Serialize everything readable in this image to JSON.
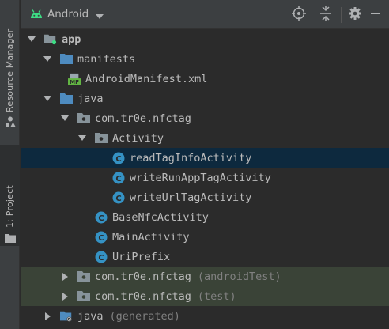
{
  "side_tabs": {
    "resource_manager": "Resource Manager",
    "project": "1: Project"
  },
  "header": {
    "view_label": "Android"
  },
  "tree": {
    "app": "app",
    "manifests": "manifests",
    "android_manifest": "AndroidManifest.xml",
    "java": "java",
    "pkg_main": "com.tr0e.nfctag",
    "activity_folder": "Activity",
    "read_tag": "readTagInfoActivity",
    "write_run_app": "writeRunAppTagActivity",
    "write_url": "writeUrlTagActivity",
    "base_nfc": "BaseNfcActivity",
    "main_activity": "MainActivity",
    "uri_prefix": "UriPrefix",
    "pkg_android_test": "com.tr0e.nfctag",
    "pkg_android_test_suffix": "(androidTest)",
    "pkg_test": "com.tr0e.nfctag",
    "pkg_test_suffix": "(test)",
    "java_generated": "java",
    "java_generated_suffix": "(generated)"
  },
  "colors": {
    "background": "#2b2b2b",
    "header": "#3c3f41",
    "selected_row": "#0d293e",
    "test_row": "#3a4337",
    "android_green": "#3ddc84",
    "folder_blue": "#4e8bbf",
    "class_icon": "#3592c4"
  }
}
